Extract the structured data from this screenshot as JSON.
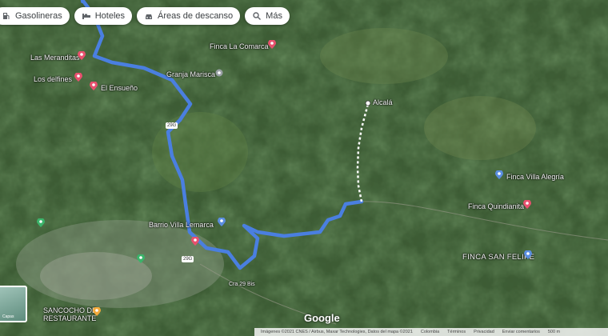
{
  "chips": [
    {
      "label": "Gasolineras",
      "icon": "gas-station-icon"
    },
    {
      "label": "Hoteles",
      "icon": "bed-icon"
    },
    {
      "label": "Áreas de descanso",
      "icon": "car-icon"
    },
    {
      "label": "Más",
      "icon": "search-icon"
    }
  ],
  "places": {
    "las_meranditas": "Las Meranditas",
    "los_delfines": "Los delfines",
    "el_ensueno": "El Ensueño",
    "finca_la_comarca": "Finca La Comarca",
    "granja_marisca": "Granja Marisca",
    "alcala": "Alcalá",
    "finca_villa_alegria": "Finca Villa Alegría",
    "finca_quindianita": "Finca Quindianita",
    "finca_san_felipe": "FINCA SAN FELIPE",
    "barrio": "Barrio Villa Lemarca",
    "restaurante": "SANCOCHO DE\nRESTAURANTE",
    "carrera": "Cra 29 Bis"
  },
  "road_shield": "29G",
  "thumbnail_label": "Capas",
  "brand": "Google",
  "footer": [
    "Imágenes ©2021 CNES / Airbus, Maxar Technologies, Datos del mapa ©2021",
    "Colombia",
    "Términos",
    "Privacidad",
    "Enviar comentarios",
    "500 m"
  ],
  "colors": {
    "route": "#4a7fe0",
    "pin_red": "#e8506e",
    "pin_blue": "#5b8ee0",
    "pin_orange": "#f2a93b",
    "pin_green": "#3bb36a"
  }
}
